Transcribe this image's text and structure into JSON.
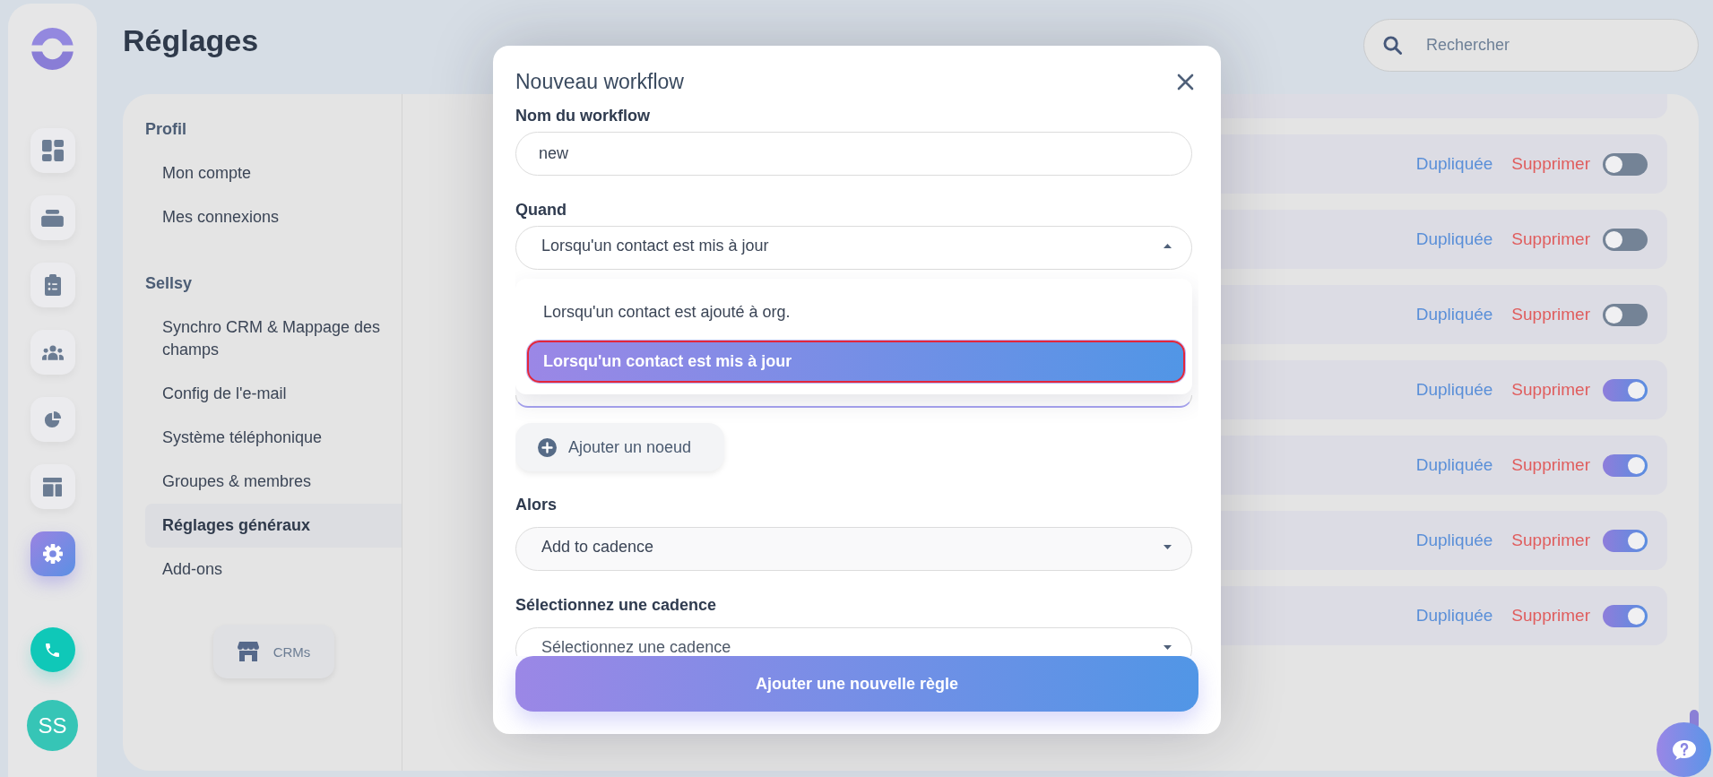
{
  "rail": {
    "nav": [
      {
        "selected": false
      },
      {
        "selected": false
      },
      {
        "selected": false
      },
      {
        "selected": false
      },
      {
        "selected": false
      },
      {
        "selected": false
      },
      {
        "selected": true
      }
    ],
    "avatar": "SS"
  },
  "page": {
    "title": "Réglages"
  },
  "search": {
    "placeholder": "Rechercher"
  },
  "settings_nav": {
    "sections": [
      {
        "title": "Profil",
        "items": [
          {
            "label": "Mon compte",
            "selected": false
          },
          {
            "label": "Mes connexions",
            "selected": false
          }
        ]
      },
      {
        "title": "Sellsy",
        "items": [
          {
            "label": "Synchro CRM & Mappage des champs",
            "selected": false
          },
          {
            "label": "Config de l'e-mail",
            "selected": false
          },
          {
            "label": "Système téléphonique",
            "selected": false
          },
          {
            "label": "Groupes & membres",
            "selected": false
          },
          {
            "label": "Réglages généraux",
            "selected": true
          },
          {
            "label": "Add-ons",
            "selected": false
          }
        ]
      }
    ],
    "crm_button": "CRMs"
  },
  "rules": [
    {
      "duplicate": "Dupliquée",
      "delete": "Supprimer",
      "on": false
    },
    {
      "duplicate": "Dupliquée",
      "delete": "Supprimer",
      "on": false
    },
    {
      "duplicate": "Dupliquée",
      "delete": "Supprimer",
      "on": false
    },
    {
      "duplicate": "Dupliquée",
      "delete": "Supprimer",
      "on": true
    },
    {
      "duplicate": "Dupliquée",
      "delete": "Supprimer",
      "on": true
    },
    {
      "duplicate": "Dupliquée",
      "delete": "Supprimer",
      "on": true
    },
    {
      "duplicate": "Dupliquée",
      "delete": "Supprimer",
      "on": true
    }
  ],
  "modal": {
    "title": "Nouveau workflow",
    "fields": [
      {
        "kind": "text",
        "label": "Nom du workflow",
        "value": "new"
      },
      {
        "kind": "select",
        "label": "Quand",
        "value": "Lorsqu'un contact est mis à jour",
        "expanded": true,
        "options": [
          {
            "label": "Lorsqu'un contact est ajouté à org.",
            "selected": false
          },
          {
            "label": "Lorsqu'un contact est mis à jour",
            "selected": true
          }
        ]
      },
      {
        "kind": "node"
      },
      {
        "kind": "button",
        "label": "Ajouter un noeud"
      },
      {
        "kind": "select",
        "label": "Alors",
        "value": "Add to cadence",
        "expanded": false
      },
      {
        "kind": "select",
        "label": "Sélectionnez une cadence",
        "placeholder": "Sélectionnez une cadence",
        "expanded": false
      }
    ],
    "submit": "Ajouter une nouvelle règle"
  }
}
